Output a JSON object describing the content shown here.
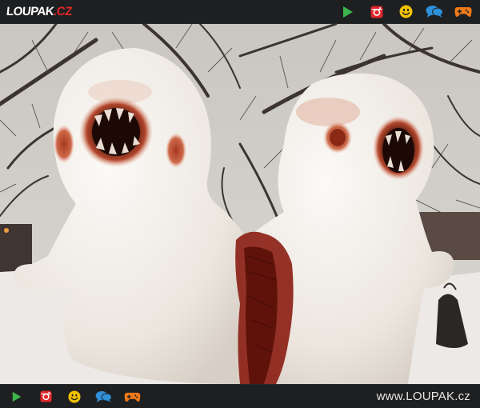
{
  "header": {
    "logo_main": "LOUPAK",
    "logo_dot": ".",
    "logo_tld": "CZ",
    "icons": [
      "play-icon",
      "instagram-icon",
      "smiley-icon",
      "chat-icon",
      "gamepad-icon"
    ]
  },
  "footer": {
    "icons": [
      "play-icon",
      "instagram-icon",
      "smiley-icon",
      "chat-icon",
      "gamepad-icon"
    ],
    "site_url": "www.LOUPAK.cz"
  },
  "colors": {
    "bar_bg": "#1e1f21",
    "play": "#3cb54a",
    "instagram": "#e0262a",
    "smiley": "#f2c200",
    "chat": "#2f8fd8",
    "gamepad": "#f07a1a",
    "logo_accent": "#e0262a"
  }
}
